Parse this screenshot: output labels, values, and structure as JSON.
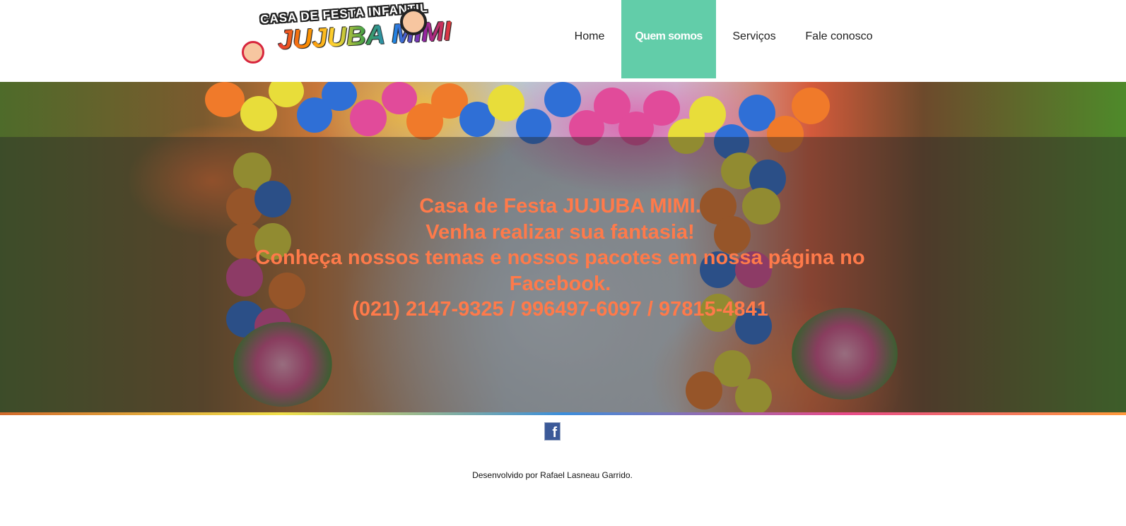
{
  "logo": {
    "top_text": "CASA DE FESTA INFANTIL",
    "main_text": "JUJUBA MIMI"
  },
  "nav": {
    "items": [
      {
        "label": "Home",
        "active": false
      },
      {
        "label": "Quem somos",
        "active": true
      },
      {
        "label": "Serviços",
        "active": false
      },
      {
        "label": "Fale conosco",
        "active": false
      }
    ]
  },
  "hero": {
    "lines": [
      "Casa de Festa JUJUBA MIMI.",
      "Venha realizar sua fantasia!",
      "Conheça nossos temas e nossos pacotes em nossa página no Facebook.",
      "(021) 2147-9325 / 996497-6097 / 97815-4841"
    ]
  },
  "footer": {
    "facebook_icon": "facebook-icon",
    "credit": "Desenvolvido por Rafael Lasneau Garrido."
  },
  "colors": {
    "accent": "#62cda9",
    "hero_text": "#ff7a4a",
    "facebook": "#3b5998"
  }
}
